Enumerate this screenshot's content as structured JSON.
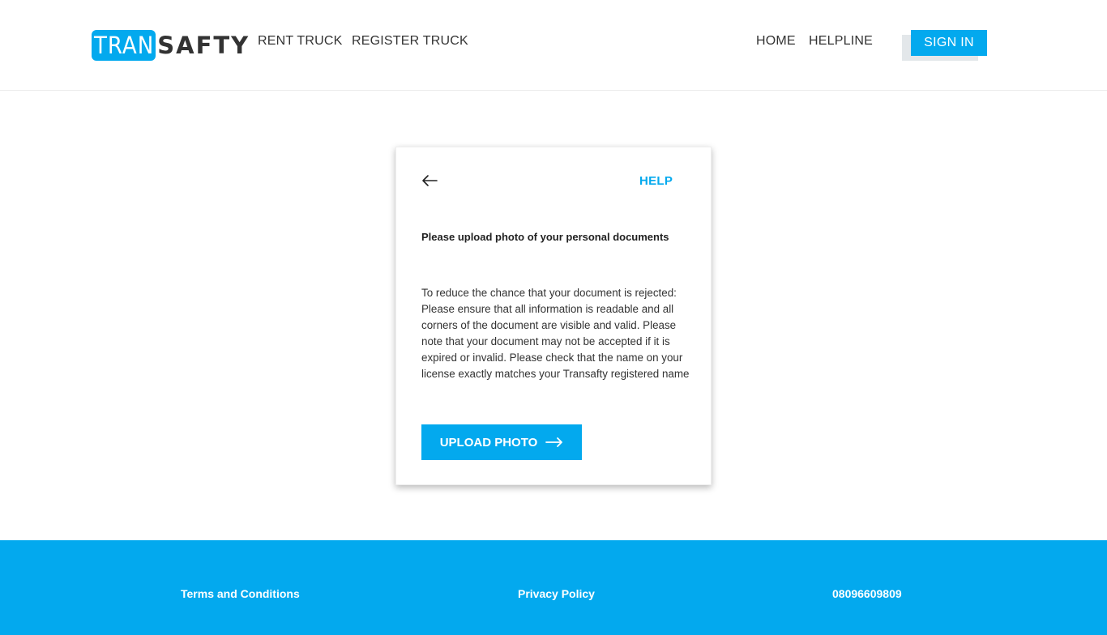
{
  "brand": {
    "part1": "TRAN",
    "part2": "SAFTY",
    "accent_color": "#03a9ee"
  },
  "nav": {
    "left": [
      "RENT TRUCK",
      "REGISTER TRUCK"
    ],
    "right": [
      "HOME",
      "HELPLINE"
    ],
    "signin_label": "SIGN IN"
  },
  "card": {
    "back_icon": "arrow-left-icon",
    "help_label": "HELP",
    "title": "Please upload photo of your personal documents",
    "description": "To reduce the chance that your document is rejected: Please ensure that all information is readable and all corners of the document are visible and valid. Please note that your document may not be accepted if it is expired or invalid. Please check that the name on your license exactly matches your Transafty registered name",
    "upload_label": "UPLOAD PHOTO",
    "upload_icon": "arrow-right-icon"
  },
  "footer": {
    "terms": "Terms and Conditions",
    "privacy": "Privacy Policy",
    "phone": "08096609809"
  }
}
